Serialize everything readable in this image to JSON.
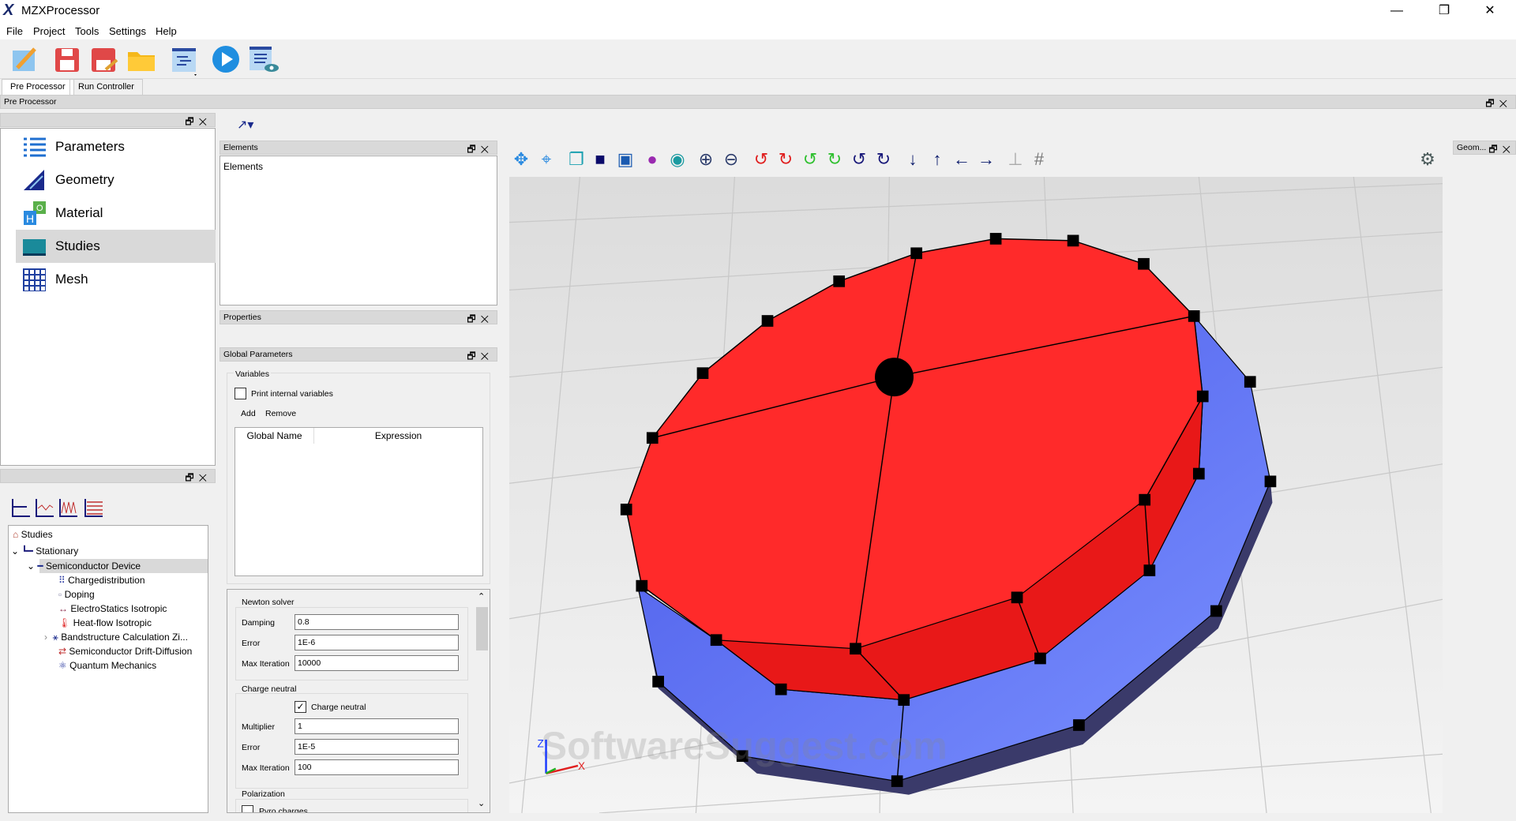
{
  "app": {
    "title": "MZXProcessor",
    "minimize": "—",
    "maximize": "❐",
    "close": "✕"
  },
  "menu": [
    "File",
    "Project",
    "Tools",
    "Settings",
    "Help"
  ],
  "tabs": [
    "Pre Processor",
    "Run Controller"
  ],
  "preprocessor_bar": "Pre Processor",
  "nav": [
    "Parameters",
    "Geometry",
    "Material",
    "Studies",
    "Mesh"
  ],
  "tree": {
    "root": "Studies",
    "stationary": "Stationary",
    "device": "Semiconductor Device",
    "children": [
      "Chargedistribution",
      "Doping",
      "ElectroStatics Isotropic",
      "Heat-flow Isotropic",
      "Bandstructure Calculation Zi...",
      "Semiconductor Drift-Diffusion",
      "Quantum Mechanics"
    ]
  },
  "elements": {
    "header": "Elements",
    "content": "Elements"
  },
  "properties": {
    "header": "Properties"
  },
  "global_params": {
    "header": "Global Parameters",
    "group": "Variables",
    "print_internal": "Print internal variables",
    "add": "Add",
    "remove": "Remove",
    "columns": [
      "Global Name",
      "Expression"
    ]
  },
  "newton": {
    "title": "Newton solver",
    "damping_label": "Damping",
    "damping": "0.8",
    "error_label": "Error",
    "error": "1E-6",
    "maxit_label": "Max Iteration",
    "maxit": "10000"
  },
  "charge": {
    "title": "Charge neutral",
    "checkbox": "Charge neutral",
    "checked": true,
    "mult_label": "Multiplier",
    "mult": "1",
    "error_label": "Error",
    "error": "1E-5",
    "maxit_label": "Max Iteration",
    "maxit": "100"
  },
  "polarization": {
    "title": "Polarization",
    "pyro": "Pyro charges"
  },
  "geom_dock": "Geom...",
  "axes": {
    "z": "Z",
    "x": "X"
  },
  "watermark": "SoftwareSuggest.com",
  "colors": {
    "top_face": "#ff2a2a",
    "side_face": "#5a72f0",
    "node": "#000000"
  }
}
